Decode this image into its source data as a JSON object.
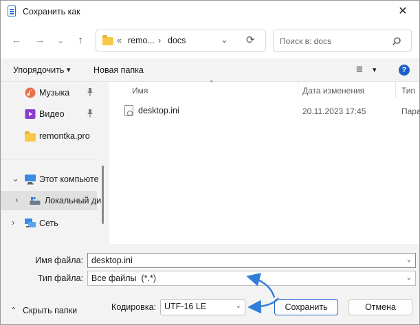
{
  "window": {
    "title": "Сохранить как",
    "close_glyph": "✕"
  },
  "nav": {
    "back_glyph": "←",
    "forward_glyph": "→",
    "recent_glyph": "⌄",
    "up_glyph": "↑",
    "breadcrumb": {
      "overflow": "«",
      "parent": "remo...",
      "sep": "›",
      "current": "docs"
    },
    "address_dropdown_glyph": "⌄",
    "refresh_glyph": "⟳",
    "search_placeholder": "Поиск в: docs"
  },
  "toolbar": {
    "organize": "Упорядочить",
    "organize_caret": "▾",
    "new_folder": "Новая папка",
    "view_glyph": "≡",
    "view_caret": "▾",
    "help_glyph": "?"
  },
  "sidebar": {
    "items": [
      {
        "label": "Музыка",
        "icon": "music-icon",
        "pinned": true
      },
      {
        "label": "Видео",
        "icon": "video-icon",
        "pinned": true
      },
      {
        "label": "remontka.pro",
        "icon": "folder-icon",
        "pinned": false
      },
      {
        "label": "Этот компьюте",
        "icon": "computer-icon",
        "expand": "⌄"
      },
      {
        "label": "Локальный ди",
        "icon": "drive-icon",
        "expand": "›"
      },
      {
        "label": "Сеть",
        "icon": "network-icon",
        "expand": "›"
      }
    ],
    "pin_glyph": "📌"
  },
  "file_list": {
    "columns": [
      "Имя",
      "Дата изменения",
      "Тип"
    ],
    "sort_glyph": "⌃",
    "rows": [
      {
        "name": "desktop.ini",
        "modified": "20.11.2023 17:45",
        "type": "Пара"
      }
    ]
  },
  "form": {
    "filename_label": "Имя файла:",
    "filename_value": "desktop.ini",
    "filetype_label": "Тип файла:",
    "filetype_value": "Все файлы  (*.*)",
    "encoding_label": "Кодировка:",
    "encoding_value": "UTF-16 LE",
    "dropdown_glyph": "⌄"
  },
  "buttons": {
    "hide_folders": "Скрыть папки",
    "hide_caret": "⌃",
    "save": "Сохранить",
    "cancel": "Отмена"
  },
  "colors": {
    "accent": "#1a5fc7",
    "annotation": "#2f7fd8",
    "folder": "#f7c948"
  }
}
